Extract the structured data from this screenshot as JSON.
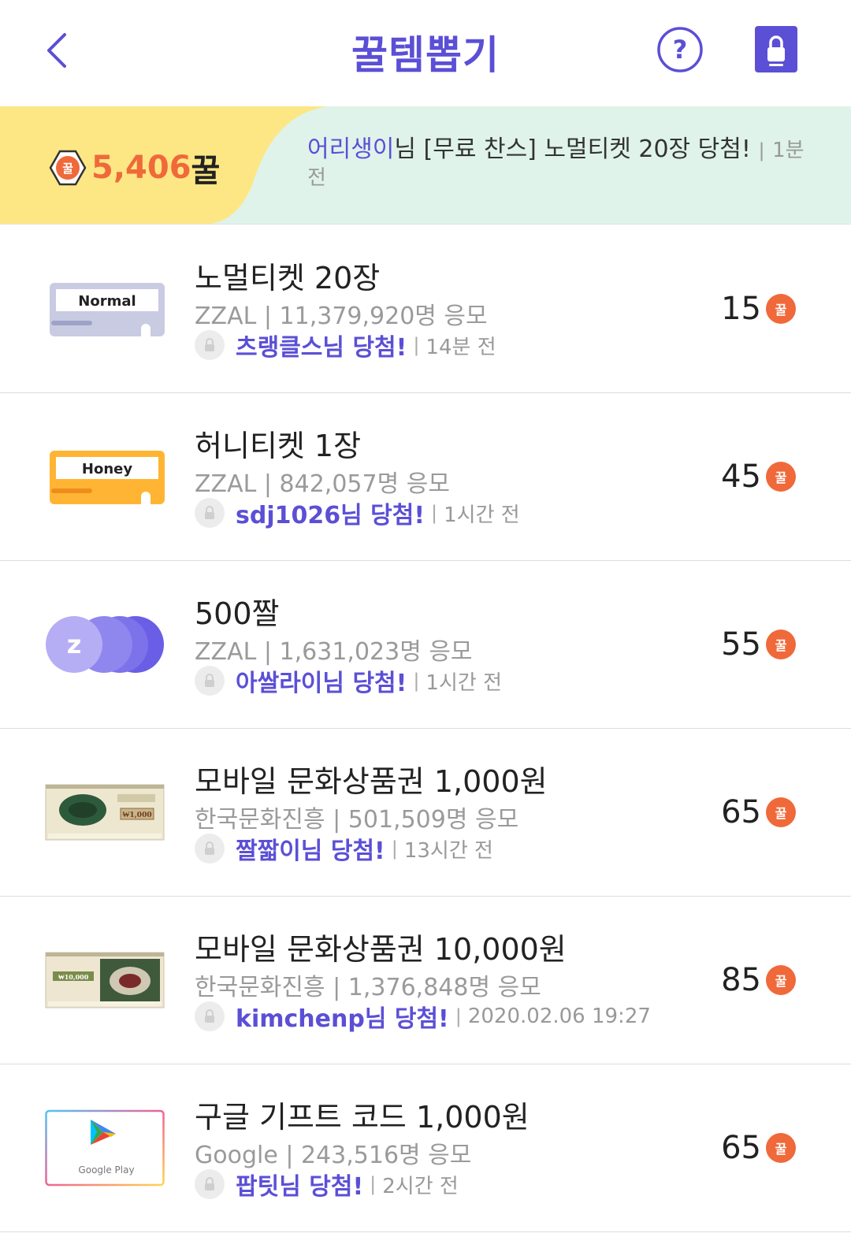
{
  "header": {
    "title": "꿀템뽑기",
    "help_label": "?"
  },
  "banner": {
    "points_icon_label": "꿀",
    "points_value": "5,406",
    "points_unit": "꿀",
    "ticker_user": "어리생이",
    "ticker_text": "님 [무료 찬스] 노멀티켓 20장 당첨!",
    "ticker_sep": "|",
    "ticker_time": "1분 전"
  },
  "coin_label": "꿀",
  "items": [
    {
      "thumb": "normal-ticket",
      "thumb_label": "Normal",
      "name": "노멀티켓 20장",
      "sub": "ZZAL | 11,379,920명 응모",
      "winner": "츠랭클스님 당첨!",
      "sep": "|",
      "time": "14분 전",
      "price": "15"
    },
    {
      "thumb": "honey-ticket",
      "thumb_label": "Honey",
      "name": "허니티켓 1장",
      "sub": "ZZAL | 842,057명 응모",
      "winner": "sdj1026님 당첨!",
      "sep": "|",
      "time": "1시간 전",
      "price": "45"
    },
    {
      "thumb": "zzal-coins",
      "thumb_label": "z",
      "name": "500짤",
      "sub": "ZZAL | 1,631,023명 응모",
      "winner": "아쌀라이님 당첨!",
      "sep": "|",
      "time": "1시간 전",
      "price": "55"
    },
    {
      "thumb": "gift-card-1000",
      "thumb_label": "₩1,000",
      "name": "모바일 문화상품권 1,000원",
      "sub": "한국문화진흥 | 501,509명 응모",
      "winner": "짤짧이님 당첨!",
      "sep": "|",
      "time": "13시간 전",
      "price": "65"
    },
    {
      "thumb": "gift-card-10000",
      "thumb_label": "₩10,000",
      "name": "모바일 문화상품권 10,000원",
      "sub": "한국문화진흥 | 1,376,848명 응모",
      "winner": "kimchenp님 당첨!",
      "sep": "|",
      "time": "2020.02.06 19:27",
      "price": "85"
    },
    {
      "thumb": "google-play-card",
      "thumb_label": "Google Play",
      "name": "구글 기프트 코드 1,000원",
      "sub": "Google | 243,516명 응모",
      "winner": "팝팃님 당첨!",
      "sep": "|",
      "time": "2시간 전",
      "price": "65"
    }
  ],
  "colors": {
    "accent": "#5b4fd6",
    "points": "#f0693a",
    "banner_yellow": "#fde784",
    "banner_mint": "#dff3ea"
  }
}
